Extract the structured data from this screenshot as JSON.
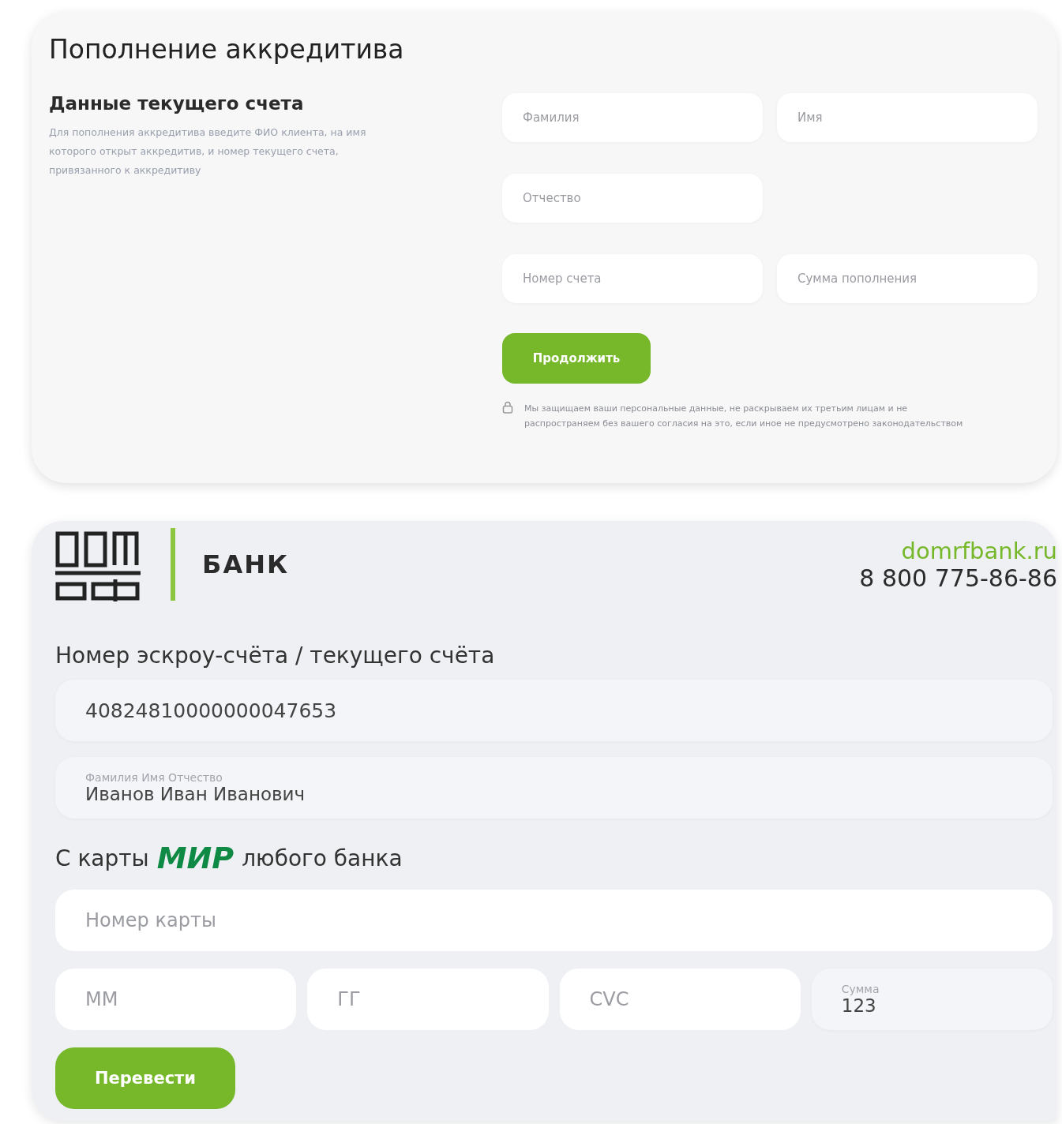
{
  "top_form": {
    "title": "Пополнение аккредитива",
    "section_title": "Данные текущего счета",
    "section_description": "Для пополнения аккредитива введите ФИО клиента, на имя которого открыт аккредитив, и номер текущего счета, привязанного к аккредитиву",
    "field_rows": [
      [
        {
          "placeholder": "Фамилия"
        },
        {
          "placeholder": "Имя"
        }
      ],
      [
        {
          "placeholder": "Отчество"
        }
      ],
      [
        {
          "placeholder": "Номер счета"
        },
        {
          "placeholder": "Сумма пополнения"
        }
      ]
    ],
    "button": "Продолжить",
    "privacy_note": "Мы защищаем ваши персональные данные, не раскрываем их третьим лицам и не распространяем без вашего согласия на это, если иное не предусмотрено законодательством"
  },
  "bottom_form": {
    "brand_label": "БАНК",
    "site": "domrfbank.ru",
    "phone": "8 800 775-86-86",
    "account_title": "Номер эскроу-счёта / текущего счёта",
    "account_fields": [
      {
        "value": "40824810000000047653"
      },
      {
        "label": "Фамилия Имя Отчество",
        "value": "Иванов Иван Иванович"
      }
    ],
    "card_title_before": "С карты",
    "card_brand": "МИР",
    "card_title_after": "любого банка",
    "card_number": {
      "placeholder": "Номер карты"
    },
    "card_fields": [
      {
        "placeholder": "ММ"
      },
      {
        "placeholder": "ГГ"
      },
      {
        "placeholder": "CVC"
      },
      {
        "label": "Сумма",
        "value": "123"
      }
    ],
    "button": "Перевести"
  }
}
